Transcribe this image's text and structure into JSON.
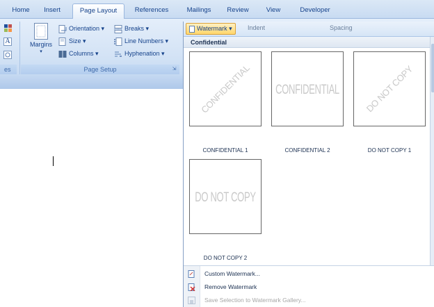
{
  "tabs": [
    "Home",
    "Insert",
    "Page Layout",
    "References",
    "Mailings",
    "Review",
    "View",
    "Developer"
  ],
  "active_tab": "Page Layout",
  "ribbon": {
    "partial_left": {
      "letter": "A",
      "label_fragment": "es"
    },
    "page_setup": {
      "margins_label": "Margins",
      "orientation_label": "Orientation ▾",
      "size_label": "Size ▾",
      "columns_label": "Columns ▾",
      "breaks_label": "Breaks ▾",
      "line_numbers_label": "Line Numbers ▾",
      "hyphenation_label": "Hyphenation ▾",
      "group_label": "Page Setup"
    }
  },
  "gallery_toolbar": {
    "watermark_label": "Watermark ▾",
    "indent_label": "Indent",
    "spacing_label": "Spacing"
  },
  "gallery": {
    "section_header": "Confidential",
    "items": [
      {
        "watermark": "CONFIDENTIAL",
        "caption": "CONFIDENTIAL 1",
        "style": "diagonal"
      },
      {
        "watermark": "CONFIDENTIAL",
        "caption": "CONFIDENTIAL 2",
        "style": "horizontal"
      },
      {
        "watermark": "DO NOT COPY",
        "caption": "DO NOT COPY 1",
        "style": "diagonal"
      },
      {
        "watermark": "DO NOT COPY",
        "caption": "DO NOT COPY 2",
        "style": "horizontal"
      }
    ]
  },
  "menu": {
    "custom": {
      "label": "Custom Watermark...",
      "icon": "custom-watermark-icon",
      "enabled": true
    },
    "remove": {
      "label": "Remove Watermark",
      "icon": "remove-watermark-icon",
      "enabled": true
    },
    "save": {
      "label": "Save Selection to Watermark Gallery...",
      "icon": "save-gallery-icon",
      "enabled": false
    }
  },
  "colors": {
    "ribbon_bg": "#d2e2f5",
    "accent": "#15428b",
    "watermark_highlight": "#ffd66b"
  }
}
